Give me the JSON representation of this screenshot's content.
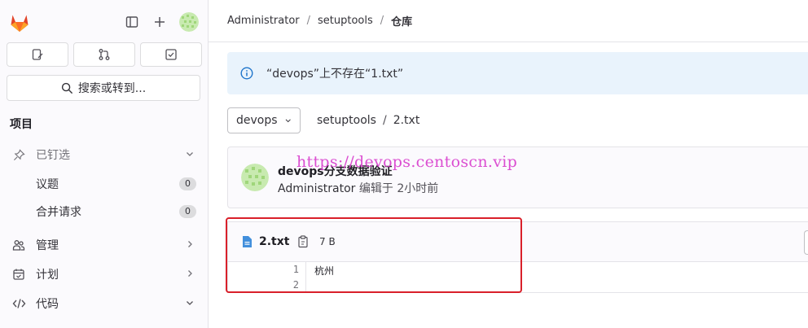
{
  "sidebar": {
    "search_label": "搜索或转到...",
    "section_title": "项目",
    "items": [
      {
        "label": "已钉选",
        "icon": "pin-icon"
      },
      {
        "label": "议题",
        "count": "0"
      },
      {
        "label": "合并请求",
        "count": "0"
      },
      {
        "label": "管理",
        "icon": "users-icon"
      },
      {
        "label": "计划",
        "icon": "calendar-icon"
      },
      {
        "label": "代码",
        "icon": "code-icon"
      }
    ]
  },
  "breadcrumb": {
    "items": [
      "Administrator",
      "setuptools",
      "仓库"
    ]
  },
  "alert": {
    "message": "“devops”上不存在“1.txt”"
  },
  "repo": {
    "branch": "devops",
    "path_project": "setuptools",
    "path_file": "2.txt"
  },
  "commit": {
    "title": "devops分支数据验证",
    "author": "Administrator",
    "action": "编辑于",
    "time": "2小时前"
  },
  "watermark": "https://devops.centoscn.vip",
  "file": {
    "name": "2.txt",
    "size": "7 B",
    "lines": [
      {
        "num": "1",
        "text": "杭州"
      },
      {
        "num": "2",
        "text": ""
      }
    ]
  },
  "colors": {
    "accent_info": "#1f75cb",
    "highlight": "#d9202a",
    "watermark": "#d83ccd",
    "gitlab_orange": "#e24329"
  }
}
